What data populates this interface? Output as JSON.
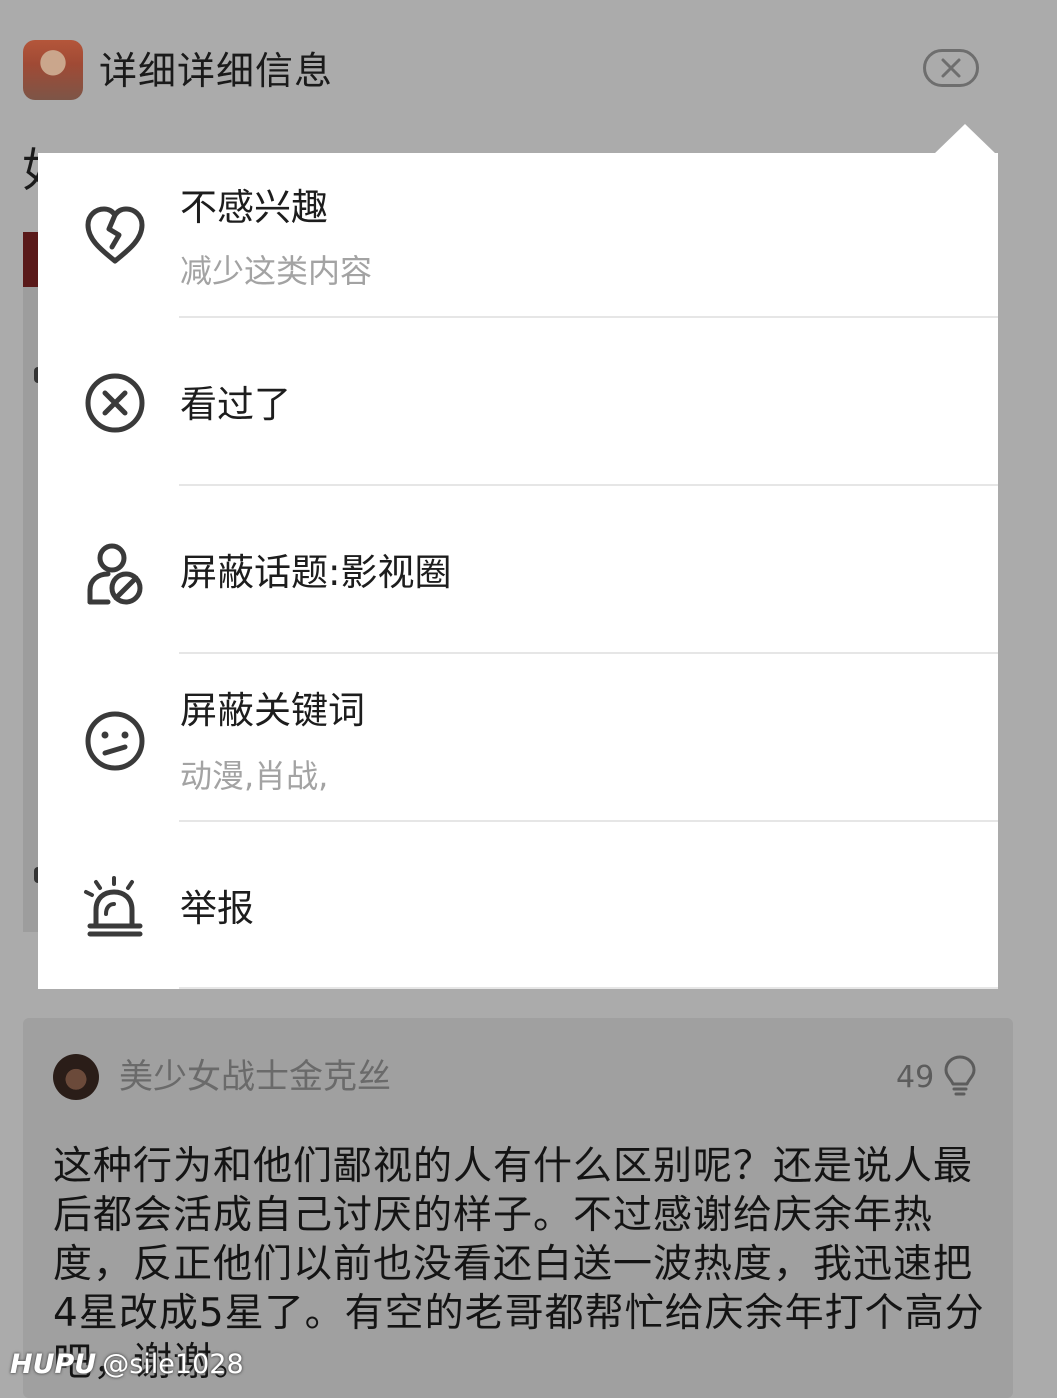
{
  "header": {
    "title": "详细详细信息",
    "close_icon": "close-icon"
  },
  "background": {
    "headline_fragment": "如"
  },
  "menu": {
    "items": [
      {
        "title": "不感兴趣",
        "subtitle": "减少这类内容",
        "icon": "broken-heart-icon"
      },
      {
        "title": "看过了",
        "subtitle": "",
        "icon": "x-circle-icon"
      },
      {
        "title": "屏蔽话题:影视圈",
        "subtitle": "",
        "icon": "block-topic-icon"
      },
      {
        "title": "屏蔽关键词",
        "subtitle": "动漫,肖战,",
        "icon": "confused-face-icon"
      },
      {
        "title": "举报",
        "subtitle": "",
        "icon": "alarm-icon"
      }
    ]
  },
  "comment": {
    "username": "美少女战士金克丝",
    "likes": "49",
    "text": "这种行为和他们鄙视的人有什么区别呢？还是说人最后都会活成自己讨厌的样子。不过感谢给庆余年热度，反正他们以前也没看还白送一波热度，我迅速把4星改成5星了。有空的老哥都帮忙给庆余年打个高分吧，谢谢。"
  },
  "watermark": {
    "logo": "HUPU",
    "handle": "@sile1028"
  },
  "colors": {
    "overlay": "#ababab",
    "popup_bg": "#ffffff",
    "divider": "#e6e6e6",
    "subtitle": "#a3a3a3",
    "icon_stroke": "#3a3a3a"
  }
}
